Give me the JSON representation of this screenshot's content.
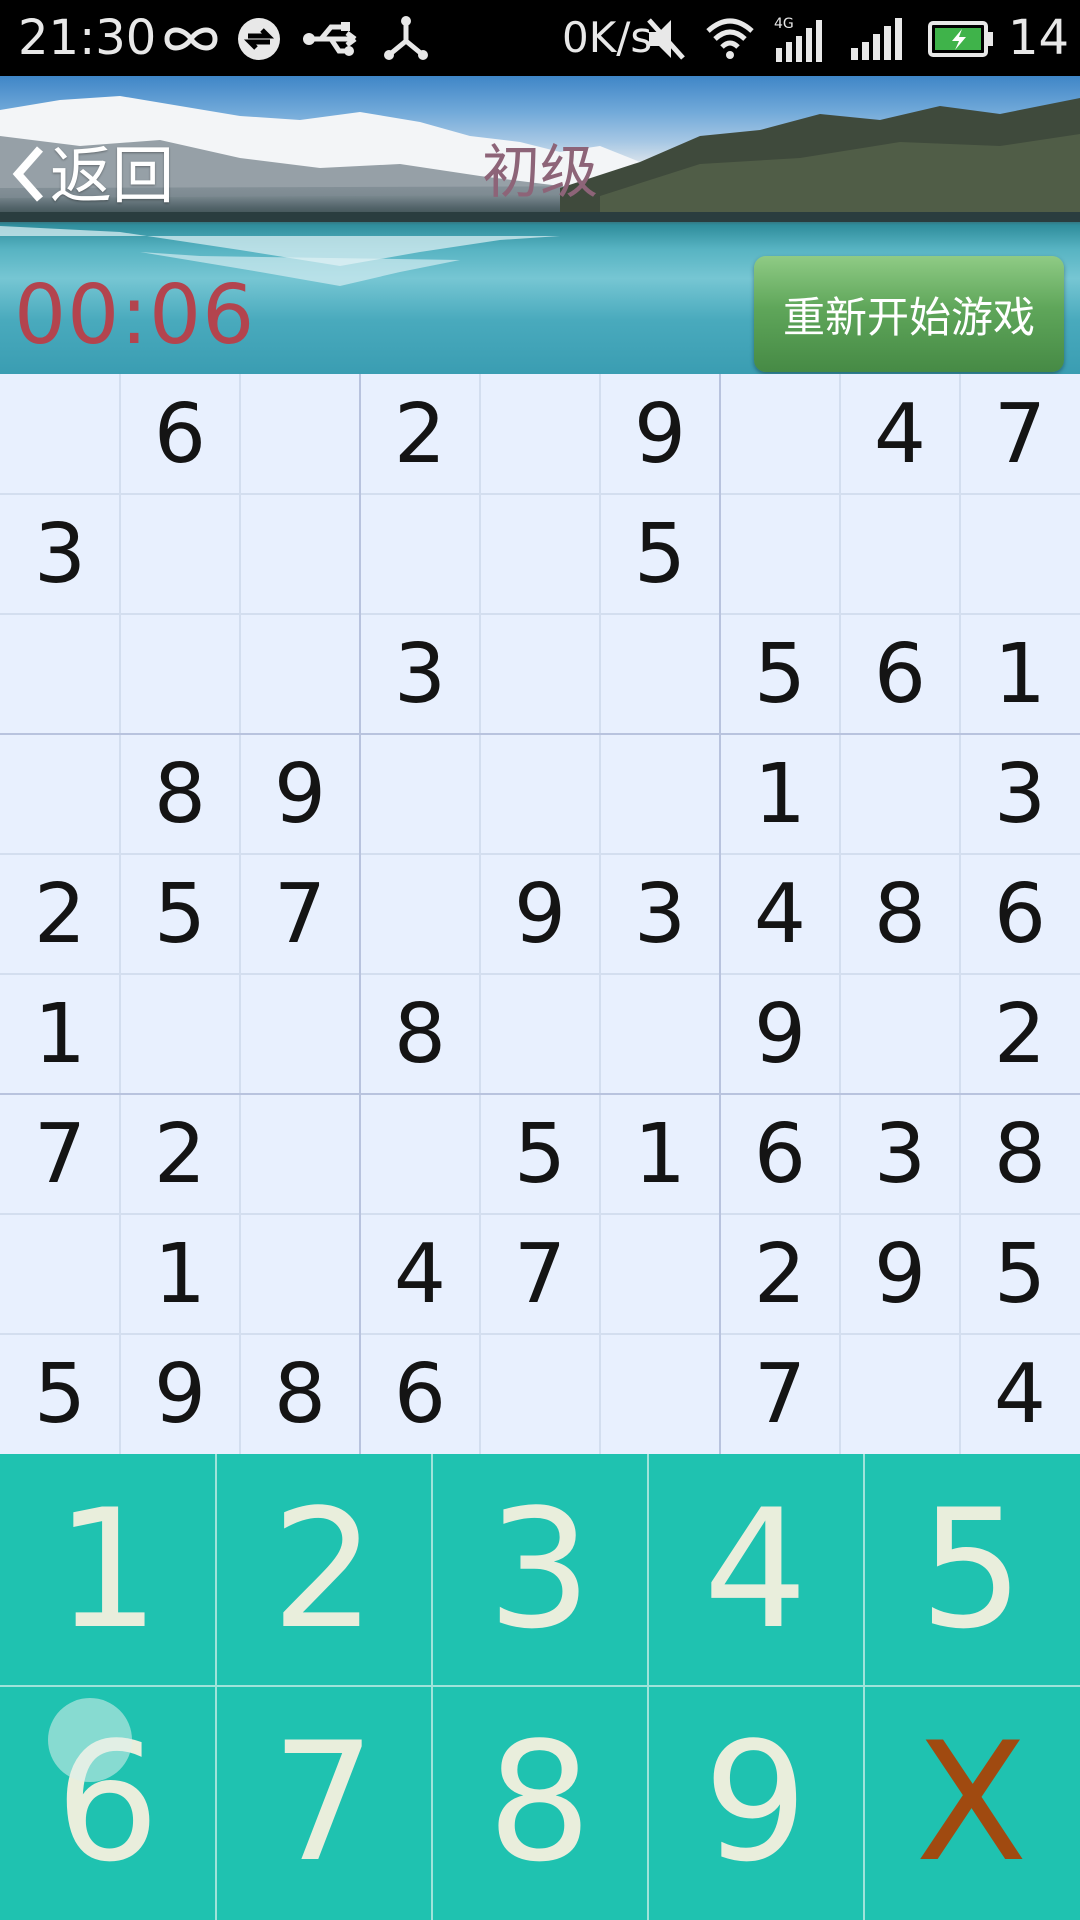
{
  "status_bar": {
    "time": "21:30",
    "net_speed": "0K/s",
    "battery_percent": "14",
    "icons": [
      "infinity-icon",
      "sync-icon",
      "usb-icon",
      "share-icon",
      "mute-icon",
      "wifi-icon",
      "signal-4g-icon",
      "signal-icon",
      "battery-charging-icon"
    ]
  },
  "header": {
    "back_label": "返回",
    "title": "初级",
    "timer": "00:06",
    "restart_label": "重新开始游戏"
  },
  "board": {
    "grid": [
      [
        "",
        "6",
        "",
        "2",
        "",
        "9",
        "",
        "4",
        "7"
      ],
      [
        "3",
        "",
        "",
        "",
        "",
        "5",
        "",
        "",
        ""
      ],
      [
        "",
        "",
        "",
        "3",
        "",
        "",
        "5",
        "6",
        "1"
      ],
      [
        "",
        "8",
        "9",
        "",
        "",
        "",
        "1",
        "",
        "3"
      ],
      [
        "2",
        "5",
        "7",
        "",
        "9",
        "3",
        "4",
        "8",
        "6"
      ],
      [
        "1",
        "",
        "",
        "8",
        "",
        "",
        "9",
        "",
        "2"
      ],
      [
        "7",
        "2",
        "",
        "",
        "5",
        "1",
        "6",
        "3",
        "8"
      ],
      [
        "",
        "1",
        "",
        "4",
        "7",
        "",
        "2",
        "9",
        "5"
      ],
      [
        "5",
        "9",
        "8",
        "6",
        "",
        "",
        "7",
        "",
        "4"
      ]
    ]
  },
  "keypad": {
    "keys": [
      "1",
      "2",
      "3",
      "4",
      "5",
      "6",
      "7",
      "8",
      "9",
      "X"
    ]
  },
  "colors": {
    "board_bg": "#e8f0fe",
    "keypad_bg": "#1fc2b0",
    "key_text": "#e9eedc",
    "clear_key": "#a04a10",
    "timer": "#b3444e",
    "title": "#8d6478",
    "restart_button": "#5fa65a"
  }
}
